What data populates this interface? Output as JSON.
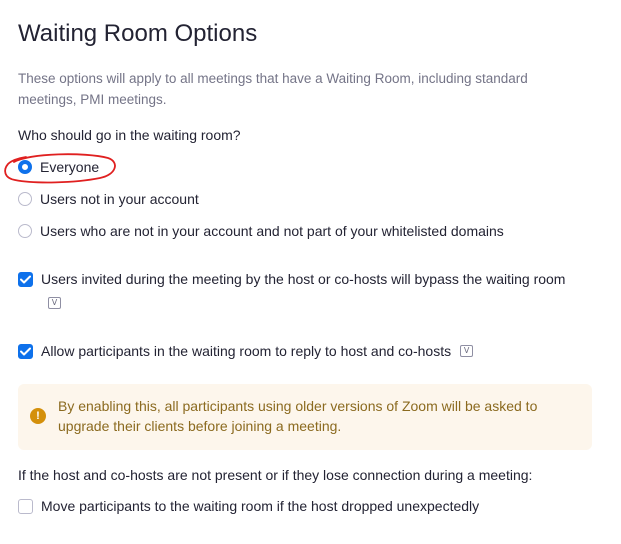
{
  "page": {
    "title": "Waiting Room Options",
    "description": "These options will apply to all meetings that have a Waiting Room, including standard meetings, PMI meetings."
  },
  "who_section": {
    "question": "Who should go in the waiting room?",
    "options": [
      {
        "label": "Everyone",
        "selected": true
      },
      {
        "label": "Users not in your account",
        "selected": false
      },
      {
        "label": "Users who are not in your account and not part of your whitelisted domains",
        "selected": false
      }
    ]
  },
  "checkboxes": {
    "bypass": {
      "label": "Users invited during the meeting by the host or co-hosts will bypass the waiting room",
      "checked": true,
      "badge": "V"
    },
    "reply": {
      "label": "Allow participants in the waiting room to reply to host and co-hosts",
      "checked": true,
      "badge": "V"
    },
    "move": {
      "label": "Move participants to the waiting room if the host dropped unexpectedly",
      "checked": false
    }
  },
  "notice": {
    "icon": "!",
    "text": "By enabling this, all participants using older versions of Zoom will be asked to upgrade their clients before joining a meeting."
  },
  "host_section": {
    "question": "If the host and co-hosts are not present or if they lose connection during a meeting:"
  },
  "colors": {
    "accent": "#0e71eb",
    "notice_bg": "#fdf6ec",
    "notice_icon": "#d4900b",
    "annotation": "#e02020"
  }
}
